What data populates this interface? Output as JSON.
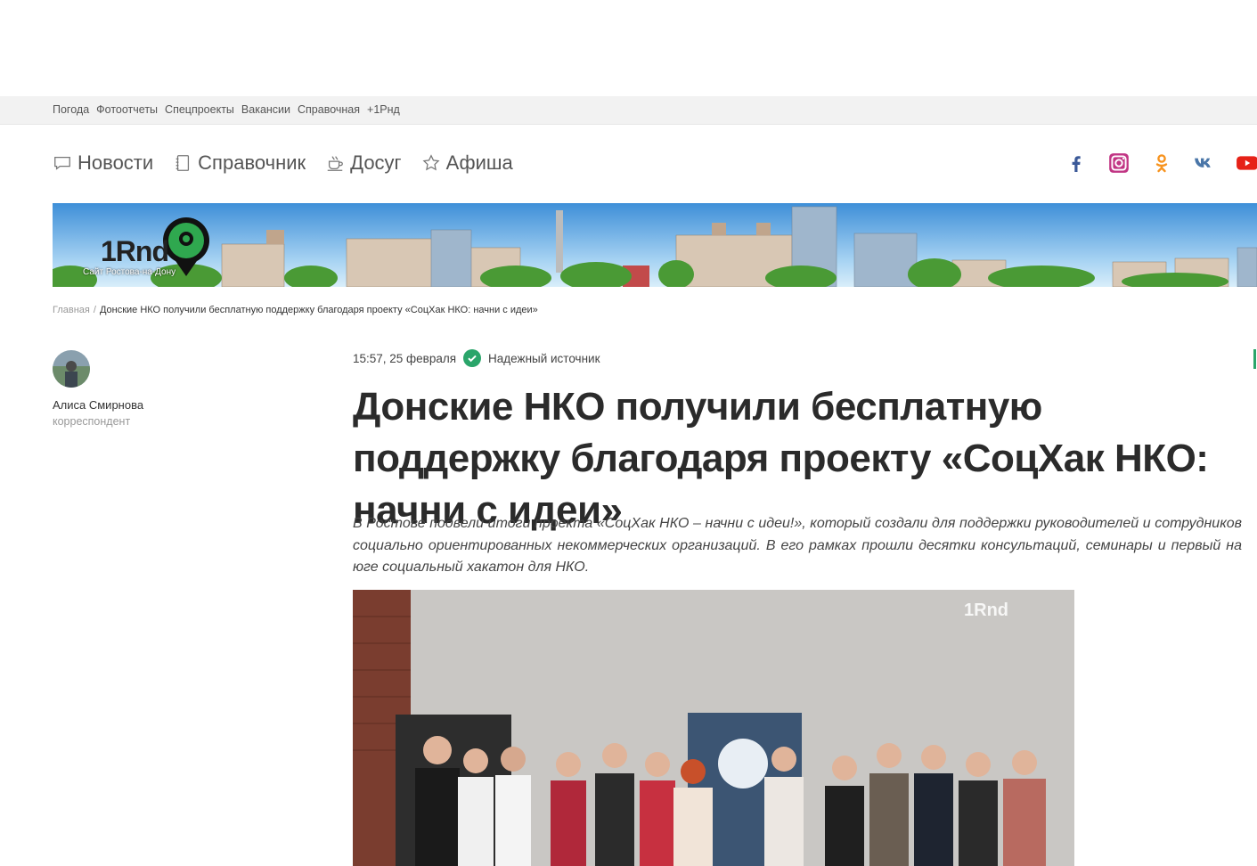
{
  "topbar": {
    "links": [
      "Погода",
      "Фотоотчеты",
      "Спецпроекты",
      "Вакансии",
      "Справочная",
      "+1Рнд"
    ]
  },
  "mainnav": {
    "items": [
      {
        "label": "Новости",
        "icon": "speech-bubble-icon"
      },
      {
        "label": "Справочник",
        "icon": "notebook-icon"
      },
      {
        "label": "Досуг",
        "icon": "coffee-cup-icon"
      },
      {
        "label": "Афиша",
        "icon": "star-icon"
      }
    ]
  },
  "social": [
    {
      "name": "facebook-icon",
      "color": "#3b5998"
    },
    {
      "name": "instagram-icon",
      "color": "#c13584"
    },
    {
      "name": "odnoklassniki-icon",
      "color": "#f7931e"
    },
    {
      "name": "vk-icon",
      "color": "#4a76a8"
    },
    {
      "name": "youtube-icon",
      "color": "#e62117"
    }
  ],
  "banner": {
    "logo": "1Rnd",
    "tagline": "Сайт Ростова-на-Дону"
  },
  "breadcrumb": {
    "home": "Главная",
    "separator": "/",
    "current": "Донские НКО получили бесплатную поддержку благодаря проекту «СоцХак НКО: начни с идеи»"
  },
  "author": {
    "name": "Алиса Смирнова",
    "role": "корреспондент"
  },
  "article": {
    "time": "15:57, 25 февраля",
    "source_badge": "Надежный источник",
    "title": "Донские НКО получили бесплатную поддержку благодаря проекту «СоцХак НКО: начни с идеи»",
    "lead": "В Ростове подвели итоги проекта «СоцХак НКО – начни с идеи!», который создали для поддержки руководителей и сотрудников социально ориентированных некоммерческих организаций. В его рамках прошли десятки консультаций, семинары и первый на юге социальный хакатон для НКО.",
    "photo_watermark": "1Rnd"
  },
  "colors": {
    "accent_green": "#2aa56a",
    "topbar_bg": "#f2f2f2"
  }
}
